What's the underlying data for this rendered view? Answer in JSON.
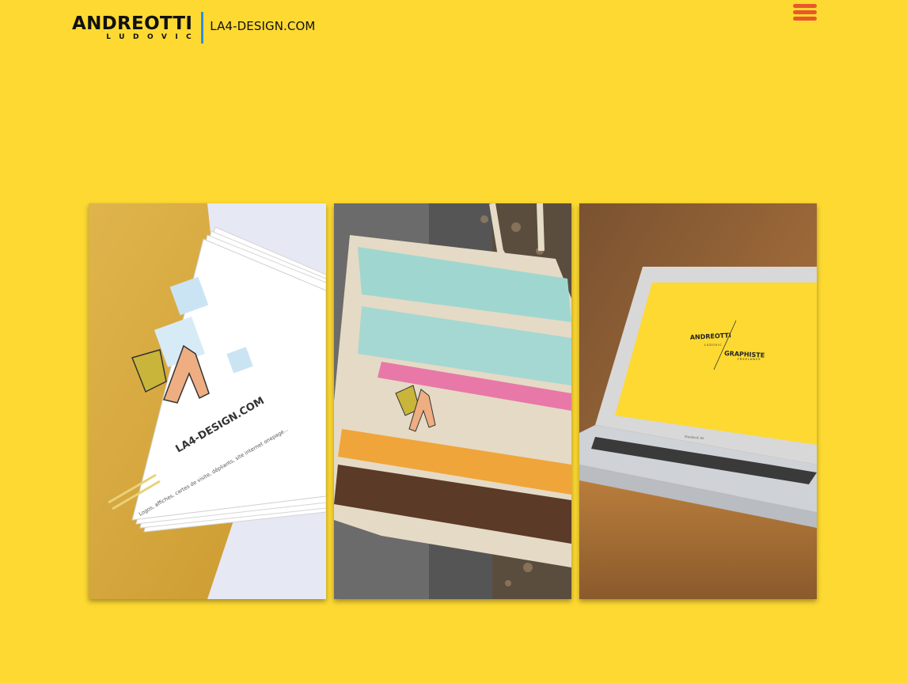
{
  "header": {
    "brand_main": "ANDREOTTI",
    "brand_sub": "LUDOVIC",
    "site": "LA4-DESIGN.COM",
    "menu_icon": "hamburger-menu-icon"
  },
  "portfolio": {
    "card1": {
      "site": "LA4-DESIGN.COM",
      "tagline": "Logos, affiches, cartes de visite, dépliants, site internet onepage..."
    },
    "card2": {},
    "card3": {
      "screen_main": "ANDREOTTI",
      "screen_sub": "LUDOVIC",
      "screen_right": "GRAPHISTE",
      "screen_right_sub": "FREELANCE",
      "laptop_brand": "MacBook Air"
    }
  },
  "colors": {
    "background": "#fdd932",
    "accent_blue": "#2f8ee0",
    "menu_orange": "#e9572a"
  }
}
